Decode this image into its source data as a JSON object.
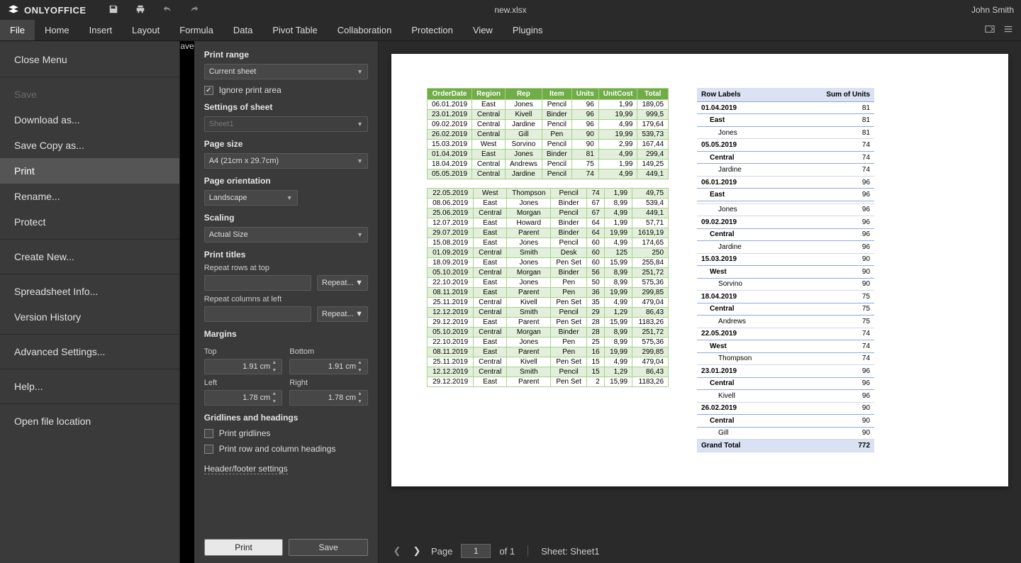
{
  "app": {
    "name": "ONLYOFFICE",
    "document": "new.xlsx",
    "user": "John Smith"
  },
  "menubar": [
    "File",
    "Home",
    "Insert",
    "Layout",
    "Formula",
    "Data",
    "Pivot Table",
    "Collaboration",
    "Protection",
    "View",
    "Plugins"
  ],
  "menubar_active": "File",
  "file_menu": [
    {
      "key": "close",
      "label": "Close Menu"
    },
    {
      "sep": true
    },
    {
      "key": "save",
      "label": "Save",
      "disabled": true
    },
    {
      "key": "download",
      "label": "Download as..."
    },
    {
      "key": "savecopy",
      "label": "Save Copy as..."
    },
    {
      "key": "print",
      "label": "Print",
      "active": true
    },
    {
      "key": "rename",
      "label": "Rename..."
    },
    {
      "key": "protect",
      "label": "Protect"
    },
    {
      "sep": true
    },
    {
      "key": "createnew",
      "label": "Create New..."
    },
    {
      "sep": true
    },
    {
      "key": "info",
      "label": "Spreadsheet Info..."
    },
    {
      "key": "history",
      "label": "Version History"
    },
    {
      "sep": true
    },
    {
      "key": "advanced",
      "label": "Advanced Settings..."
    },
    {
      "sep": true
    },
    {
      "key": "help",
      "label": "Help..."
    },
    {
      "sep": true
    },
    {
      "key": "openloc",
      "label": "Open file location"
    }
  ],
  "settings": {
    "print_range": {
      "label": "Print range",
      "value": "Current sheet"
    },
    "ignore_print_area": {
      "label": "Ignore print area",
      "checked": true
    },
    "settings_of_sheet": {
      "label": "Settings of sheet",
      "value": "Sheet1"
    },
    "page_size": {
      "label": "Page size",
      "value": "A4 (21cm x 29.7cm)"
    },
    "page_orientation": {
      "label": "Page orientation",
      "value": "Landscape"
    },
    "scaling": {
      "label": "Scaling",
      "value": "Actual Size"
    },
    "print_titles": {
      "label": "Print titles",
      "rows_label": "Repeat rows at top",
      "cols_label": "Repeat columns at left",
      "repeat_btn": "Repeat..."
    },
    "margins": {
      "label": "Margins",
      "top_label": "Top",
      "bottom_label": "Bottom",
      "left_label": "Left",
      "right_label": "Right",
      "top": "1.91 cm",
      "bottom": "1.91 cm",
      "left": "1.78 cm",
      "right": "1.78 cm"
    },
    "gridlines": {
      "label": "Gridlines and headings",
      "print_gridlines": "Print gridlines",
      "print_headings": "Print row and column headings"
    },
    "header_footer_link": "Header/footer settings",
    "buttons": {
      "print": "Print",
      "save": "Save"
    }
  },
  "preview": {
    "page_label": "Page",
    "page_current": "1",
    "page_total": "of 1",
    "sheet_label": "Sheet: Sheet1"
  },
  "table_headers": [
    "OrderDate",
    "Region",
    "Rep",
    "Item",
    "Units",
    "UnitCost",
    "Total"
  ],
  "table_block1": [
    [
      "06.01.2019",
      "East",
      "Jones",
      "Pencil",
      "96",
      "1,99",
      "189,05"
    ],
    [
      "23.01.2019",
      "Central",
      "Kivell",
      "Binder",
      "96",
      "19,99",
      "999,5"
    ],
    [
      "09.02.2019",
      "Central",
      "Jardine",
      "Pencil",
      "96",
      "4,99",
      "179,64"
    ],
    [
      "26.02.2019",
      "Central",
      "Gill",
      "Pen",
      "90",
      "19,99",
      "539,73"
    ],
    [
      "15.03.2019",
      "West",
      "Sorvino",
      "Pencil",
      "90",
      "2,99",
      "167,44"
    ],
    [
      "01.04.2019",
      "East",
      "Jones",
      "Binder",
      "81",
      "4,99",
      "299,4"
    ],
    [
      "18.04.2019",
      "Central",
      "Andrews",
      "Pencil",
      "75",
      "1,99",
      "149,25"
    ],
    [
      "05.05.2019",
      "Central",
      "Jardine",
      "Pencil",
      "74",
      "4,99",
      "449,1"
    ]
  ],
  "table_block2": [
    [
      "22.05.2019",
      "West",
      "Thompson",
      "Pencil",
      "74",
      "1,99",
      "49,75"
    ],
    [
      "08.06.2019",
      "East",
      "Jones",
      "Binder",
      "67",
      "8,99",
      "539,4"
    ],
    [
      "25.06.2019",
      "Central",
      "Morgan",
      "Pencil",
      "67",
      "4,99",
      "449,1"
    ],
    [
      "12.07.2019",
      "East",
      "Howard",
      "Binder",
      "64",
      "1,99",
      "57,71"
    ],
    [
      "29.07.2019",
      "East",
      "Parent",
      "Binder",
      "64",
      "19,99",
      "1619,19"
    ],
    [
      "15.08.2019",
      "East",
      "Jones",
      "Pencil",
      "60",
      "4,99",
      "174,65"
    ],
    [
      "01.09.2019",
      "Central",
      "Smith",
      "Desk",
      "60",
      "125",
      "250"
    ],
    [
      "18.09.2019",
      "East",
      "Jones",
      "Pen Set",
      "60",
      "15,99",
      "255,84"
    ],
    [
      "05.10.2019",
      "Central",
      "Morgan",
      "Binder",
      "56",
      "8,99",
      "251,72"
    ],
    [
      "22.10.2019",
      "East",
      "Jones",
      "Pen",
      "50",
      "8,99",
      "575,36"
    ],
    [
      "08.11.2019",
      "East",
      "Parent",
      "Pen",
      "36",
      "19,99",
      "299,85"
    ],
    [
      "25.11.2019",
      "Central",
      "Kivell",
      "Pen Set",
      "35",
      "4,99",
      "479,04"
    ],
    [
      "12.12.2019",
      "Central",
      "Smith",
      "Pencil",
      "29",
      "1,29",
      "86,43"
    ],
    [
      "29.12.2019",
      "East",
      "Parent",
      "Pen Set",
      "28",
      "15,99",
      "1183,26"
    ],
    [
      "05.10.2019",
      "Central",
      "Morgan",
      "Binder",
      "28",
      "8,99",
      "251,72"
    ],
    [
      "22.10.2019",
      "East",
      "Jones",
      "Pen",
      "25",
      "8,99",
      "575,36"
    ],
    [
      "08.11.2019",
      "East",
      "Parent",
      "Pen",
      "16",
      "19,99",
      "299,85"
    ],
    [
      "25.11.2019",
      "Central",
      "Kivell",
      "Pen Set",
      "15",
      "4,99",
      "479,04"
    ],
    [
      "12.12.2019",
      "Central",
      "Smith",
      "Pencil",
      "15",
      "1,29",
      "86,43"
    ],
    [
      "29.12.2019",
      "East",
      "Parent",
      "Pen Set",
      "2",
      "15,99",
      "1183,26"
    ]
  ],
  "pivot": {
    "headers": [
      "Row Labels",
      "Sum of Units"
    ],
    "rows": [
      {
        "lvl": 0,
        "label": "01.04.2019",
        "val": "81"
      },
      {
        "lvl": 1,
        "label": "East",
        "val": "81"
      },
      {
        "lvl": 2,
        "label": "Jones",
        "val": "81"
      },
      {
        "lvl": 0,
        "label": "05.05.2019",
        "val": "74"
      },
      {
        "lvl": 1,
        "label": "Central",
        "val": "74"
      },
      {
        "lvl": 2,
        "label": "Jardine",
        "val": "74"
      },
      {
        "lvl": 0,
        "label": "06.01.2019",
        "val": "96"
      },
      {
        "lvl": 1,
        "label": "East",
        "val": "96"
      },
      {
        "lvl": 2,
        "label": "",
        "val": ""
      },
      {
        "lvl": 2,
        "label": "Jones",
        "val": "96"
      },
      {
        "lvl": 0,
        "label": "09.02.2019",
        "val": "96"
      },
      {
        "lvl": 1,
        "label": "Central",
        "val": "96"
      },
      {
        "lvl": 2,
        "label": "Jardine",
        "val": "96"
      },
      {
        "lvl": 0,
        "label": "15.03.2019",
        "val": "90"
      },
      {
        "lvl": 1,
        "label": "West",
        "val": "90"
      },
      {
        "lvl": 2,
        "label": "Sorvino",
        "val": "90"
      },
      {
        "lvl": 0,
        "label": "18.04.2019",
        "val": "75"
      },
      {
        "lvl": 1,
        "label": "Central",
        "val": "75"
      },
      {
        "lvl": 2,
        "label": "Andrews",
        "val": "75"
      },
      {
        "lvl": 0,
        "label": "22.05.2019",
        "val": "74"
      },
      {
        "lvl": 1,
        "label": "West",
        "val": "74"
      },
      {
        "lvl": 2,
        "label": "Thompson",
        "val": "74"
      },
      {
        "lvl": 0,
        "label": "23.01.2019",
        "val": "96"
      },
      {
        "lvl": 1,
        "label": "Central",
        "val": "96"
      },
      {
        "lvl": 2,
        "label": "Kivell",
        "val": "96"
      },
      {
        "lvl": 0,
        "label": "26.02.2019",
        "val": "90"
      },
      {
        "lvl": 1,
        "label": "Central",
        "val": "90"
      },
      {
        "lvl": 2,
        "label": "Gill",
        "val": "90"
      }
    ],
    "grand": {
      "label": "Grand Total",
      "val": "772"
    }
  }
}
